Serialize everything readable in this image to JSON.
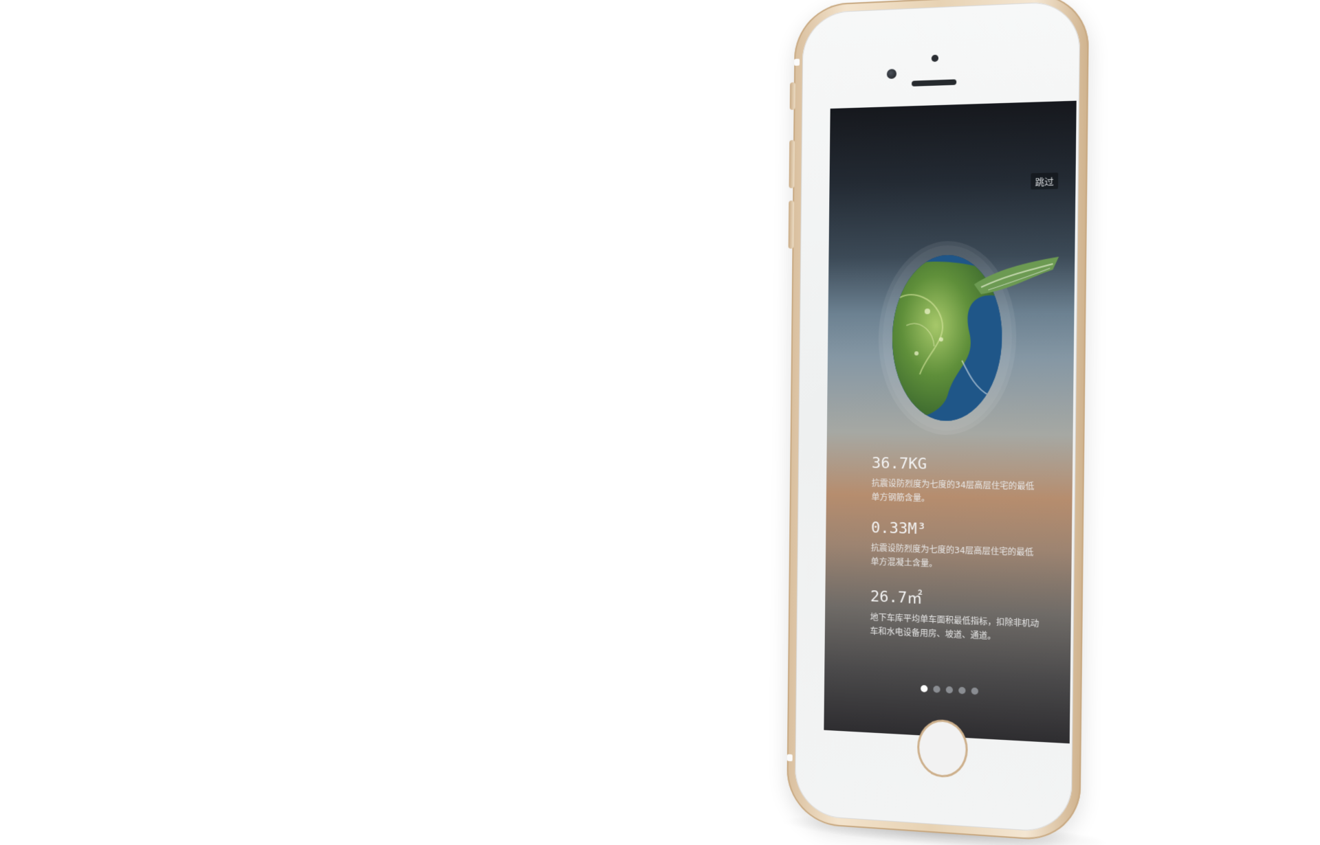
{
  "screen": {
    "skip_label": "跳过",
    "stats": [
      {
        "value": "36.7KG",
        "description": "抗震设防烈度为七度的34层高层住宅的最低单方钢筋含量。"
      },
      {
        "value": "0.33M³",
        "description": "抗震设防烈度为七度的34层高层住宅的最低单方混凝土含量。"
      },
      {
        "value": "26.7㎡",
        "description": "地下车库平均单车面积最低指标，扣除非机动车和水电设备用房、坡道、通道。"
      }
    ],
    "pager": {
      "total": 5,
      "active_index": 0
    }
  },
  "colors": {
    "phone_frame": "#e7d2b3",
    "phone_face": "#f1f2f2",
    "dot_active": "#ffffff",
    "dot_inactive": "#8a8d92"
  },
  "icons": {
    "camera": "camera-icon",
    "speaker": "speaker-icon",
    "home": "home-button-icon"
  }
}
